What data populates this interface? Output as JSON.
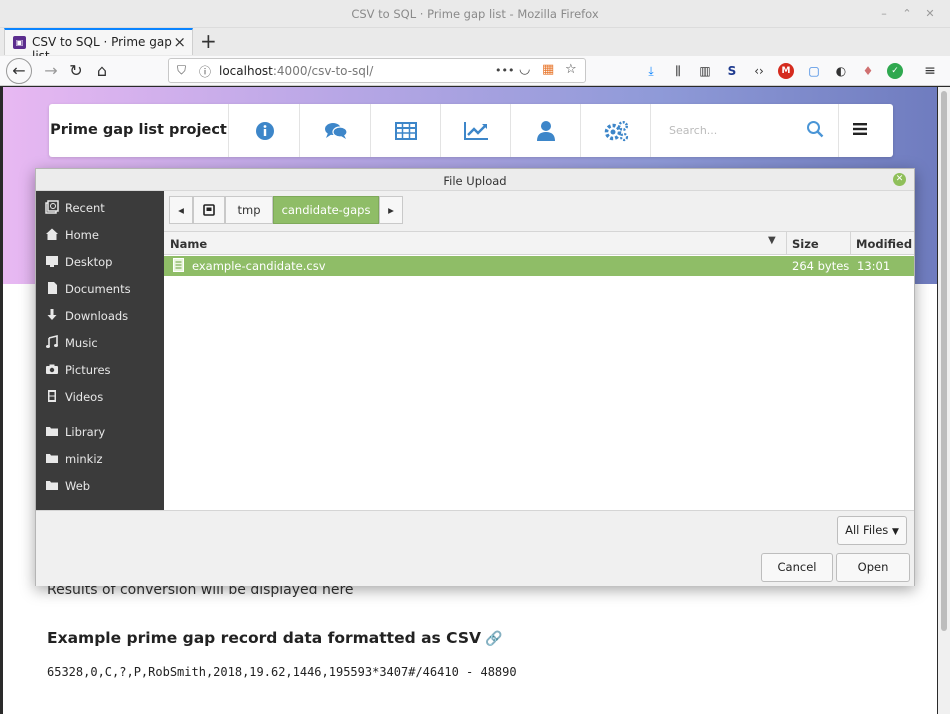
{
  "window": {
    "title": "CSV to SQL · Prime gap list - Mozilla Firefox"
  },
  "tab": {
    "label": "CSV to SQL · Prime gap list"
  },
  "urlbar": {
    "host": "localhost",
    "rest": ":4000/csv-to-sql/",
    "more": "•••"
  },
  "site": {
    "brand": "Prime gap list project",
    "nav_icons": [
      "info-icon",
      "comments-icon",
      "table-icon",
      "chart-icon",
      "user-icon",
      "cogs-icon"
    ],
    "search_placeholder": "Search...",
    "accent": "#3d86c9"
  },
  "page": {
    "results_text": "Results of conversion will be displayed here",
    "example_heading": "Example prime gap record data formatted as CSV",
    "link_symbol": "🔗",
    "csv_line": "65328,0,C,?,P,RobSmith,2018,19.62,1446,195593*3407#/46410 - 48890"
  },
  "dialog": {
    "title": "File Upload",
    "places": [
      {
        "label": "Recent",
        "icon": "recent-icon"
      },
      {
        "label": "Home",
        "icon": "home-icon"
      },
      {
        "label": "Desktop",
        "icon": "desktop-icon"
      },
      {
        "label": "Documents",
        "icon": "documents-icon"
      },
      {
        "label": "Downloads",
        "icon": "downloads-icon"
      },
      {
        "label": "Music",
        "icon": "music-icon"
      },
      {
        "label": "Pictures",
        "icon": "pictures-icon"
      },
      {
        "label": "Videos",
        "icon": "videos-icon"
      },
      {
        "label": "Library",
        "icon": "folder-icon"
      },
      {
        "label": "minkiz",
        "icon": "folder-icon"
      },
      {
        "label": "Web",
        "icon": "folder-icon"
      }
    ],
    "path": [
      "tmp",
      "candidate-gaps"
    ],
    "columns": {
      "name": "Name",
      "size": "Size",
      "modified": "Modified"
    },
    "files": [
      {
        "name": "example-candidate.csv",
        "size": "264 bytes",
        "modified": "13:01"
      }
    ],
    "filter": "All Files",
    "cancel": "Cancel",
    "open": "Open",
    "selection_color": "#8fbd67"
  }
}
